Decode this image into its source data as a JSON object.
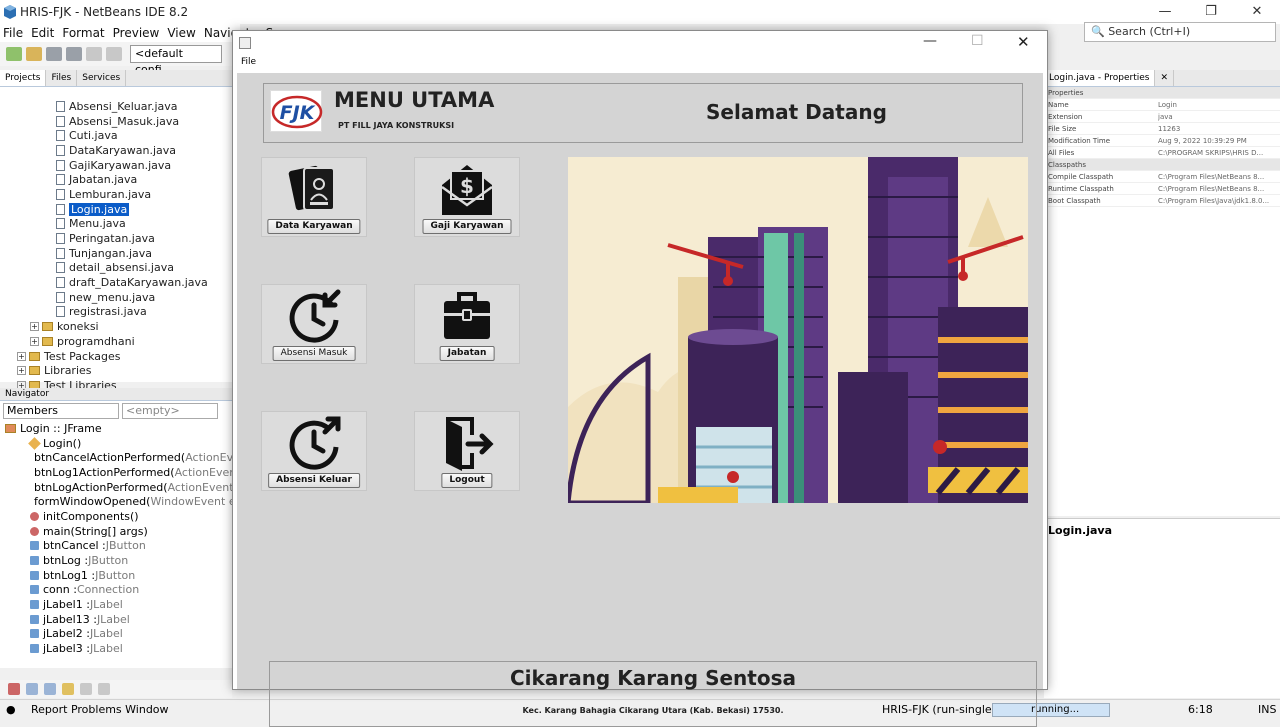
{
  "ide": {
    "title": "HRIS-FJK - NetBeans IDE 8.2",
    "menu": [
      "File",
      "Edit",
      "Format",
      "Preview",
      "View",
      "Navigate",
      "So"
    ],
    "config": "<default confi...",
    "search_placeholder": "Search (Ctrl+I)"
  },
  "projects_panel": {
    "tabs": [
      "Projects",
      "Files",
      "Services"
    ],
    "files": [
      "Absensi_Keluar.java",
      "Absensi_Masuk.java",
      "Cuti.java",
      "DataKaryawan.java",
      "GajiKaryawan.java",
      "Jabatan.java",
      "Lemburan.java",
      "Login.java",
      "Menu.java",
      "Peringatan.java",
      "Tunjangan.java",
      "detail_absensi.java",
      "draft_DataKaryawan.java",
      "new_menu.java",
      "registrasi.java"
    ],
    "selected": "Login.java",
    "folders": [
      "koneksi",
      "programdhani"
    ],
    "roots": [
      "Test Packages",
      "Libraries",
      "Test Libraries"
    ]
  },
  "navigator": {
    "title": "Navigator",
    "members": "Members",
    "filter": "<empty>",
    "root": "Login :: JFrame",
    "items": [
      {
        "name": "Login()",
        "type": ""
      },
      {
        "name": "btnCancelActionPerformed(",
        "type": "ActionEve"
      },
      {
        "name": "btnLog1ActionPerformed(",
        "type": "ActionEvent"
      },
      {
        "name": "btnLogActionPerformed(",
        "type": "ActionEvent"
      },
      {
        "name": "formWindowOpened(",
        "type": "WindowEvent ev"
      },
      {
        "name": "initComponents()",
        "type": ""
      },
      {
        "name": "main(String[] args)",
        "type": ""
      },
      {
        "name": "btnCancel : ",
        "type": "JButton"
      },
      {
        "name": "btnLog : ",
        "type": "JButton"
      },
      {
        "name": "btnLog1 : ",
        "type": "JButton"
      },
      {
        "name": "conn : ",
        "type": "Connection"
      },
      {
        "name": "jLabel1 : ",
        "type": "JLabel"
      },
      {
        "name": "jLabel13 : ",
        "type": "JLabel"
      },
      {
        "name": "jLabel2 : ",
        "type": "JLabel"
      },
      {
        "name": "jLabel3 : ",
        "type": "JLabel"
      }
    ]
  },
  "properties_panel": {
    "title": "Login.java - Properties",
    "section1": "Properties",
    "rows1": [
      {
        "k": "Name",
        "v": "Login"
      },
      {
        "k": "Extension",
        "v": "java"
      },
      {
        "k": "File Size",
        "v": "11263"
      },
      {
        "k": "Modification Time",
        "v": "Aug 9, 2022 10:39:29 PM"
      },
      {
        "k": "All Files",
        "v": "C:\\PROGRAM SKRIPS\\HRIS D..."
      }
    ],
    "section2": "Classpaths",
    "rows2": [
      {
        "k": "Compile Classpath",
        "v": "C:\\Program Files\\NetBeans 8..."
      },
      {
        "k": "Runtime Classpath",
        "v": "C:\\Program Files\\NetBeans 8..."
      },
      {
        "k": "Boot Classpath",
        "v": "C:\\Program Files\\Java\\jdk1.8.0..."
      }
    ],
    "footer_title": "Login.java"
  },
  "status": {
    "report": "Report Problems Window",
    "project": "HRIS-FJK (run-single)",
    "progress": "running...",
    "position": "6:18",
    "mode": "INS"
  },
  "app": {
    "menu_file": "File",
    "header_title": "MENU UTAMA",
    "company": "PT FILL JAYA KONSTRUKSI",
    "logo_text": "FJK",
    "welcome": "Selamat Datang",
    "buttons": {
      "data_karyawan": "Data Karyawan",
      "gaji_karyawan": "Gaji Karyawan",
      "absensi_masuk": "Absensi Masuk",
      "jabatan": "Jabatan",
      "absensi_keluar": "Absensi Keluar",
      "logout": "Logout"
    },
    "footer_title": "Cikarang Karang Sentosa",
    "footer_address": "Kec. Karang Bahagia Cikarang Utara (Kab. Bekasi) 17530."
  },
  "colors": {
    "selection": "#0b5cc8",
    "app_panel": "#d4d4d4",
    "sky": "#f6ecd2"
  }
}
